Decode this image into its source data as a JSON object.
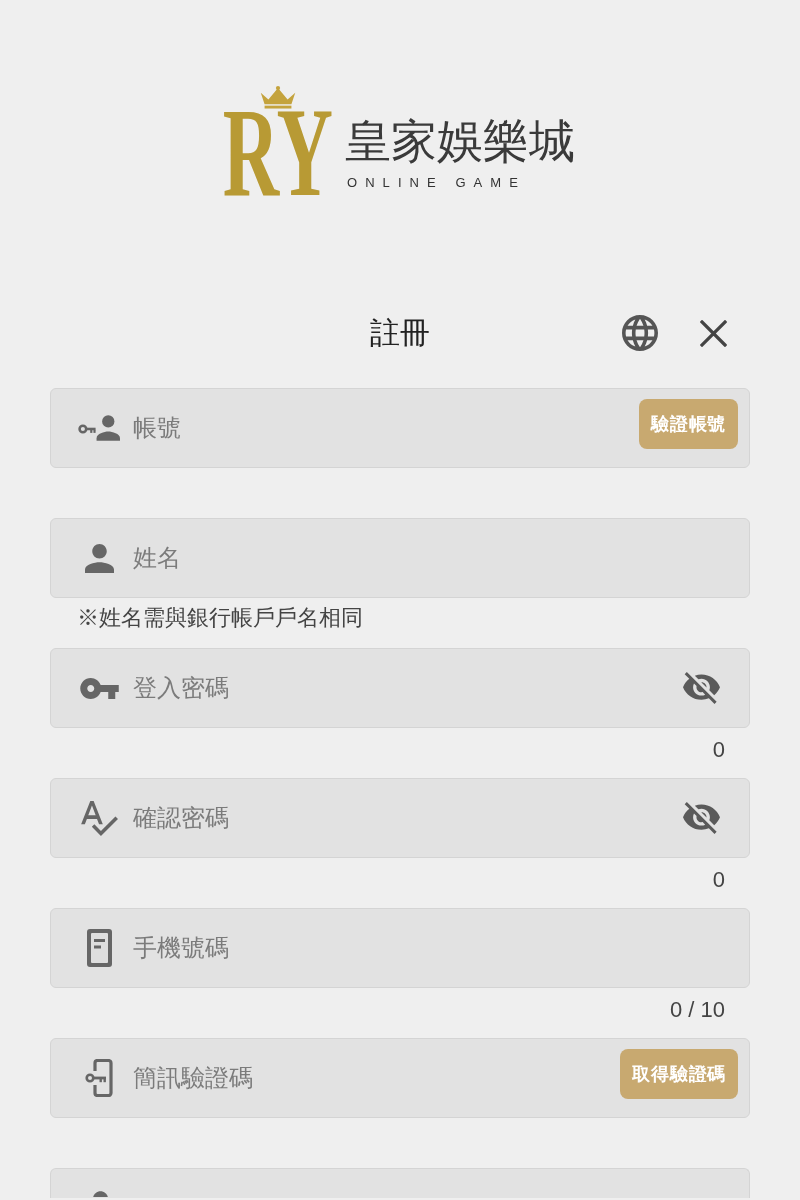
{
  "logo": {
    "mark": "RY",
    "name": "皇家娛樂城",
    "tagline": "ONLINE GAME"
  },
  "header": {
    "title": "註冊"
  },
  "fields": [
    {
      "kind": "account",
      "placeholder": "帳號",
      "button": "驗證帳號"
    },
    {
      "kind": "name",
      "placeholder": "姓名",
      "note": "※姓名需與銀行帳戶戶名相同"
    },
    {
      "kind": "password",
      "placeholder": "登入密碼",
      "revealed": false,
      "counter": "0"
    },
    {
      "kind": "confirm",
      "placeholder": "確認密碼",
      "revealed": false,
      "counter": "0"
    },
    {
      "kind": "phone",
      "placeholder": "手機號碼",
      "counter": "0 / 10"
    },
    {
      "kind": "sms",
      "placeholder": "簡訊驗證碼",
      "button": "取得驗證碼"
    },
    {
      "kind": "clipped"
    }
  ]
}
